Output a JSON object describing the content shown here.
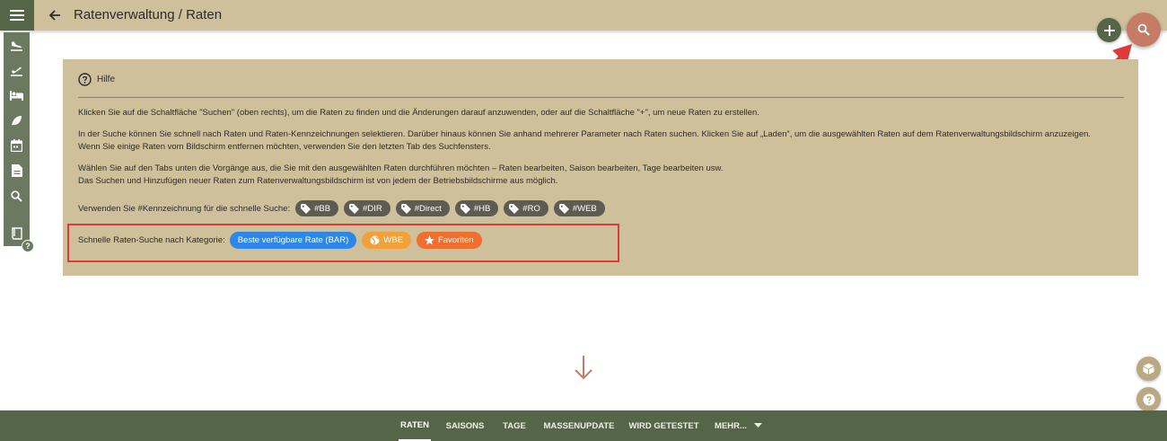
{
  "header": {
    "title": "Ratenverwaltung / Raten",
    "menu_icon": "menu-icon",
    "back_icon": "arrow-back-icon"
  },
  "fabs": {
    "add_icon": "plus-icon",
    "search_icon": "search-icon"
  },
  "left_nav": [
    {
      "icon": "flight-land-icon"
    },
    {
      "icon": "flight-takeoff-icon"
    },
    {
      "icon": "bed-icon"
    },
    {
      "icon": "leaf-icon"
    },
    {
      "icon": "calendar-icon"
    },
    {
      "icon": "document-icon"
    },
    {
      "icon": "search-icon"
    },
    {
      "icon": "book-icon"
    }
  ],
  "help": {
    "title": "Hilfe",
    "paragraphs": [
      "Klicken Sie auf die Schaltfläche \"Suchen\" (oben rechts), um die Raten zu finden und die Änderungen darauf anzuwenden, oder auf die Schaltfläche \"+\", um neue Raten zu erstellen.",
      "In der Suche können Sie schnell nach Raten und Raten-Kennzeichnungen selektieren. Darüber hinaus können Sie anhand mehrerer Parameter nach Raten suchen. Klicken Sie auf „Laden“, um die ausgewählten Raten auf dem Ratenverwaltungsbildschirm anzuzeigen.",
      "Wenn Sie einige Raten vom Bildschirm entfernen möchten, verwenden Sie den letzten Tab des Suchfensters.",
      "Wählen Sie auf den Tabs unten die Vorgänge aus, die Sie mit den ausgewählten Raten durchführen möchten – Raten bearbeiten, Saison bearbeiten, Tage bearbeiten usw.",
      "Das Suchen und Hinzufügen neuer Raten zum Ratenverwaltungsbildschirm ist von jedem der Betriebsbildschirme aus möglich."
    ],
    "tag_label": "Verwenden Sie #Kennzeichnung für die schnelle Suche:",
    "tags": [
      "#BB",
      "#DIR",
      "#Direct",
      "#HB",
      "#RO",
      "#WEB"
    ],
    "category_label": "Schnelle Raten-Suche nach Kategorie:",
    "categories": [
      {
        "label": "Beste verfügbare Rate (BAR)",
        "color": "#2e87e6"
      },
      {
        "label": "WBE",
        "color": "#f2a03a",
        "icon": "globe-icon"
      },
      {
        "label": "Favoriten",
        "color": "#ef6f2e",
        "icon": "star-icon"
      }
    ]
  },
  "bottom_tabs": [
    "RATEN",
    "SAISONS",
    "TAGE",
    "MASSENUPDATE",
    "WIRD GETESTET",
    "MEHR..."
  ],
  "active_tab": "RATEN",
  "colors": {
    "header_bg": "#cfc09c",
    "nav_bg": "#556548",
    "search_fab": "#c47c66",
    "highlight": "#e0393b"
  }
}
